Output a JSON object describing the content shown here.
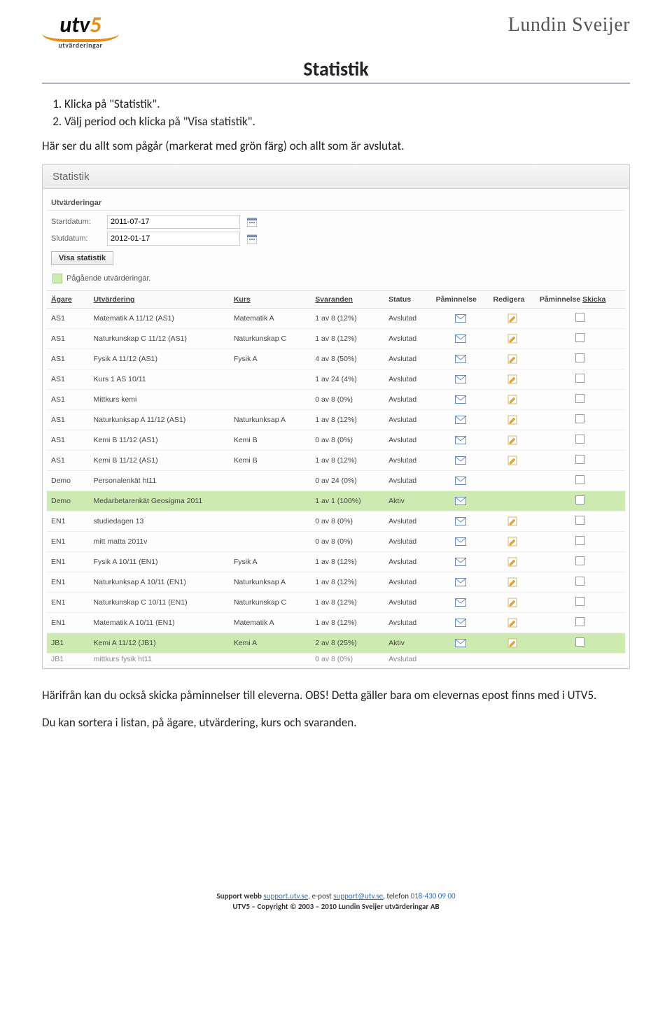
{
  "header": {
    "logo_main_a": "utv",
    "logo_main_b": "5",
    "logo_sub": "utvärderingar",
    "brand": "Lundin Sveijer"
  },
  "doc": {
    "title": "Statistik",
    "step1": "Klicka på \"Statistik\".",
    "step2": "Välj period och klicka på \"Visa statistik\".",
    "intro_note": "Här ser du allt som pågår (markerat med grön färg) och allt som är avslutat.",
    "post1": "Härifrån kan du också skicka påminnelser till eleverna. OBS! Detta gäller bara om elevernas epost finns med i UTV5.",
    "post2": "Du kan sortera i listan, på ägare, utvärdering, kurs och svaranden."
  },
  "panel": {
    "title": "Statistik",
    "section": "Utvärderingar",
    "start_label": "Startdatum:",
    "end_label": "Slutdatum:",
    "start_value": "2011-07-17",
    "end_value": "2012-01-17",
    "visa_btn": "Visa statistik",
    "legend": "Pågående utvärderingar.",
    "headers": {
      "agare": "Ägare",
      "utv": "Utvärdering",
      "kurs": "Kurs",
      "svar": "Svaranden",
      "status": "Status",
      "pam": "Påminnelse",
      "red": "Redigera",
      "skicka_a": "Påminnelse ",
      "skicka_b": "Skicka"
    },
    "rows": [
      {
        "a": "AS1",
        "u": "Matematik A 11/12 (AS1)",
        "k": "Matematik A",
        "s": "1 av 8 (12%)",
        "st": "Avslutad",
        "mail": true,
        "edit": true,
        "chk": true,
        "active": false
      },
      {
        "a": "AS1",
        "u": "Naturkunskap C 11/12 (AS1)",
        "k": "Naturkunskap C",
        "s": "1 av 8 (12%)",
        "st": "Avslutad",
        "mail": true,
        "edit": true,
        "chk": true,
        "active": false
      },
      {
        "a": "AS1",
        "u": "Fysik A 11/12 (AS1)",
        "k": "Fysik A",
        "s": "4 av 8 (50%)",
        "st": "Avslutad",
        "mail": true,
        "edit": true,
        "chk": true,
        "active": false
      },
      {
        "a": "AS1",
        "u": "Kurs 1 AS 10/11",
        "k": "",
        "s": "1 av 24 (4%)",
        "st": "Avslutad",
        "mail": true,
        "edit": true,
        "chk": true,
        "active": false
      },
      {
        "a": "AS1",
        "u": "Mittkurs kemi",
        "k": "",
        "s": "0 av 8 (0%)",
        "st": "Avslutad",
        "mail": true,
        "edit": true,
        "chk": true,
        "active": false
      },
      {
        "a": "AS1",
        "u": "Naturkunksap A 11/12 (AS1)",
        "k": "Naturkunksap A",
        "s": "1 av 8 (12%)",
        "st": "Avslutad",
        "mail": true,
        "edit": true,
        "chk": true,
        "active": false
      },
      {
        "a": "AS1",
        "u": "Kemi B 11/12 (AS1)",
        "k": "Kemi B",
        "s": "0 av 8 (0%)",
        "st": "Avslutad",
        "mail": true,
        "edit": true,
        "chk": true,
        "active": false
      },
      {
        "a": "AS1",
        "u": "Kemi B 11/12 (AS1)",
        "k": "Kemi B",
        "s": "1 av 8 (12%)",
        "st": "Avslutad",
        "mail": true,
        "edit": true,
        "chk": true,
        "active": false
      },
      {
        "a": "Demo",
        "u": "Personalenkät ht11",
        "k": "",
        "s": "0 av 24 (0%)",
        "st": "Avslutad",
        "mail": true,
        "edit": false,
        "chk": true,
        "active": false
      },
      {
        "a": "Demo",
        "u": "Medarbetarenkät Geosigma 2011",
        "k": "",
        "s": "1 av 1 (100%)",
        "st": "Aktiv",
        "mail": true,
        "edit": false,
        "chk": true,
        "active": true
      },
      {
        "a": "EN1",
        "u": "studiedagen 13",
        "k": "",
        "s": "0 av 8 (0%)",
        "st": "Avslutad",
        "mail": true,
        "edit": true,
        "chk": true,
        "active": false
      },
      {
        "a": "EN1",
        "u": "mitt matta 2011v",
        "k": "",
        "s": "0 av 8 (0%)",
        "st": "Avslutad",
        "mail": true,
        "edit": true,
        "chk": true,
        "active": false
      },
      {
        "a": "EN1",
        "u": "Fysik A 10/11 (EN1)",
        "k": "Fysik A",
        "s": "1 av 8 (12%)",
        "st": "Avslutad",
        "mail": true,
        "edit": true,
        "chk": true,
        "active": false
      },
      {
        "a": "EN1",
        "u": "Naturkunksap A 10/11 (EN1)",
        "k": "Naturkunksap A",
        "s": "1 av 8 (12%)",
        "st": "Avslutad",
        "mail": true,
        "edit": true,
        "chk": true,
        "active": false
      },
      {
        "a": "EN1",
        "u": "Naturkunskap C 10/11 (EN1)",
        "k": "Naturkunskap C",
        "s": "1 av 8 (12%)",
        "st": "Avslutad",
        "mail": true,
        "edit": true,
        "chk": true,
        "active": false
      },
      {
        "a": "EN1",
        "u": "Matematik A 10/11 (EN1)",
        "k": "Matematik A",
        "s": "1 av 8 (12%)",
        "st": "Avslutad",
        "mail": true,
        "edit": true,
        "chk": true,
        "active": false
      },
      {
        "a": "JB1",
        "u": "Kemi A 11/12 (JB1)",
        "k": "Kemi A",
        "s": "2 av 8 (25%)",
        "st": "Aktiv",
        "mail": true,
        "edit": true,
        "chk": true,
        "active": true
      }
    ],
    "cutoff": {
      "a": "JB1",
      "u": "mittkurs fysik ht11",
      "s": "0 av 8 (0%)",
      "st": "Avslutad"
    }
  },
  "footer": {
    "line1_a": "Support webb ",
    "link1": "support.utv.se",
    "line1_b": ", e-post ",
    "link2": "support@utv.se",
    "line1_c": ", telefon ",
    "phone": "018-430 09 00",
    "line2": "UTV5 – Copyright © 2003 – 2010 Lundin Sveijer utvärderingar AB"
  }
}
